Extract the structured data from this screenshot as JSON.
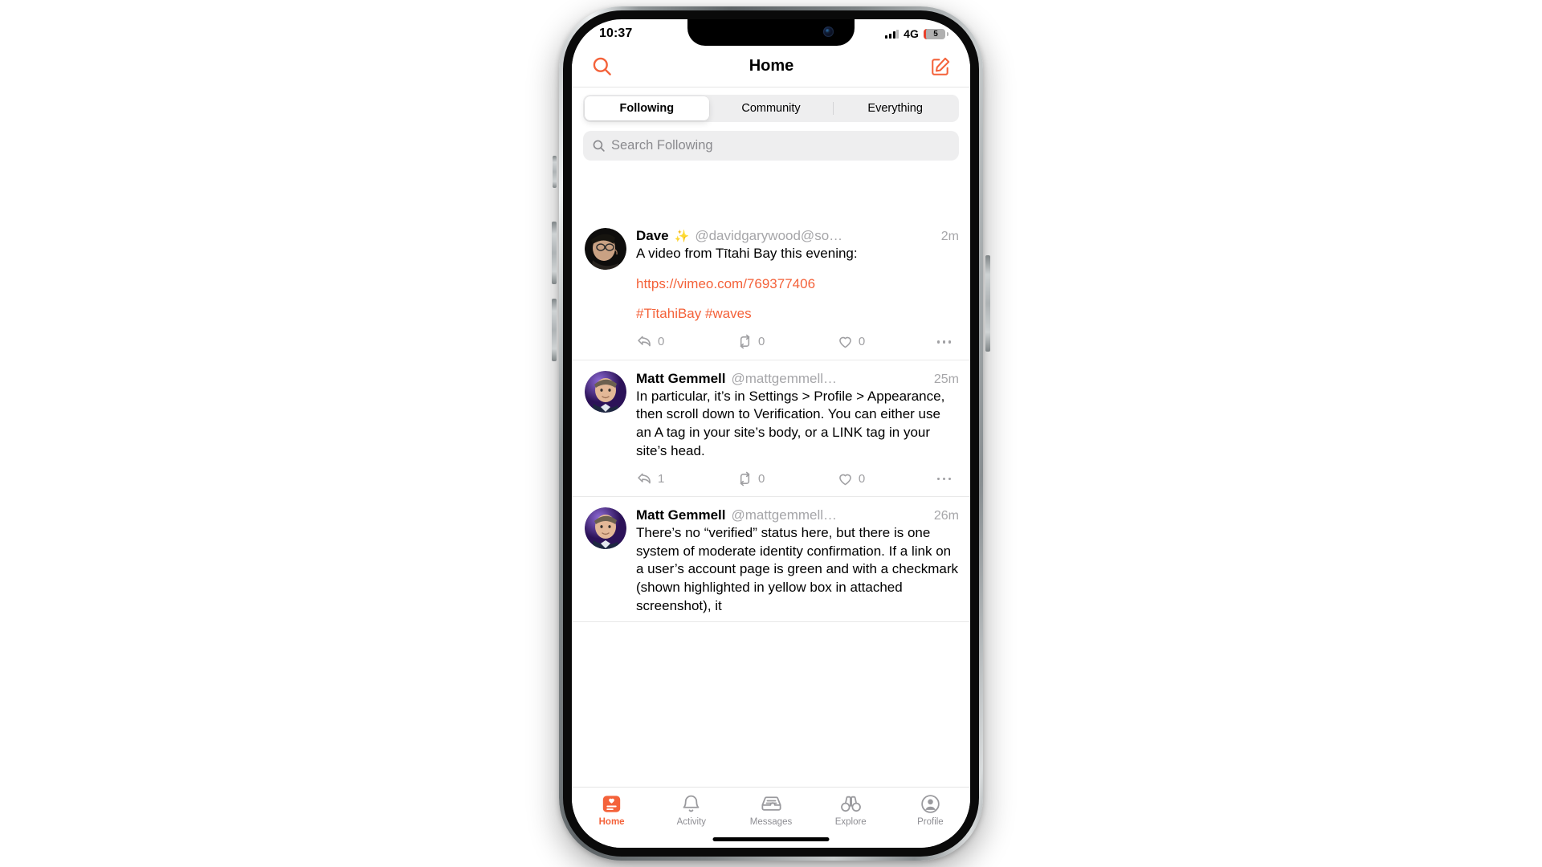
{
  "status_bar": {
    "time": "10:37",
    "network": "4G",
    "battery_level": "5",
    "signal_icon": "cellular-signal-icon",
    "battery_icon": "battery-low-icon"
  },
  "nav_bar": {
    "title": "Home",
    "search_icon": "search-icon",
    "compose_icon": "compose-icon"
  },
  "segmented_control": {
    "options": [
      {
        "label": "Following",
        "selected": true
      },
      {
        "label": "Community",
        "selected": false
      },
      {
        "label": "Everything",
        "selected": false
      }
    ]
  },
  "search_field": {
    "placeholder": "Search Following",
    "value": "",
    "icon": "magnifying-glass-icon"
  },
  "theme": {
    "accent": "#F4623A",
    "link": "#F4623A",
    "muted": "#A6A6A9",
    "background": "#FFFFFF",
    "field_background": "#EEEEEF"
  },
  "feed": {
    "posts": [
      {
        "display_name": "Dave",
        "name_emoji": "✨",
        "handle": "@davidgarywood@so…",
        "timestamp": "2m",
        "text": "A video from Tītahi Bay this evening:",
        "link": "https://vimeo.com/769377406",
        "hashtags": "#TītahiBay #waves",
        "avatar_alt": "dave-avatar",
        "actions": {
          "reply_count": "0",
          "boost_count": "0",
          "favourite_count": "0",
          "more_icon": "ellipsis-icon"
        }
      },
      {
        "display_name": "Matt Gemmell",
        "name_emoji": "",
        "handle": "@mattgemmell…",
        "timestamp": "25m",
        "text": "In particular, it’s in Settings > Profile > Appearance, then scroll down to Verification. You can either use an A tag in your site’s body, or a LINK tag in your site’s head.",
        "link": "",
        "hashtags": "",
        "avatar_alt": "matt-gemmell-avatar",
        "actions": {
          "reply_count": "1",
          "boost_count": "0",
          "favourite_count": "0",
          "more_icon": "ellipsis-icon"
        }
      },
      {
        "display_name": "Matt Gemmell",
        "name_emoji": "",
        "handle": "@mattgemmell…",
        "timestamp": "26m",
        "text": "There’s no “verified” status here, but there is one system of moderate identity confirmation. If a link on a user’s account page is green and with a checkmark (shown highlighted in yellow box in attached screenshot), it",
        "link": "",
        "hashtags": "",
        "avatar_alt": "matt-gemmell-avatar",
        "actions": {
          "reply_count": "",
          "boost_count": "",
          "favourite_count": "",
          "more_icon": ""
        }
      }
    ]
  },
  "tab_bar": {
    "tabs": [
      {
        "label": "Home",
        "icon": "home-card-heart-icon",
        "active": true
      },
      {
        "label": "Activity",
        "icon": "bell-icon",
        "active": false
      },
      {
        "label": "Messages",
        "icon": "inbox-tray-icon",
        "active": false
      },
      {
        "label": "Explore",
        "icon": "binoculars-icon",
        "active": false
      },
      {
        "label": "Profile",
        "icon": "person-circle-icon",
        "active": false
      }
    ]
  }
}
